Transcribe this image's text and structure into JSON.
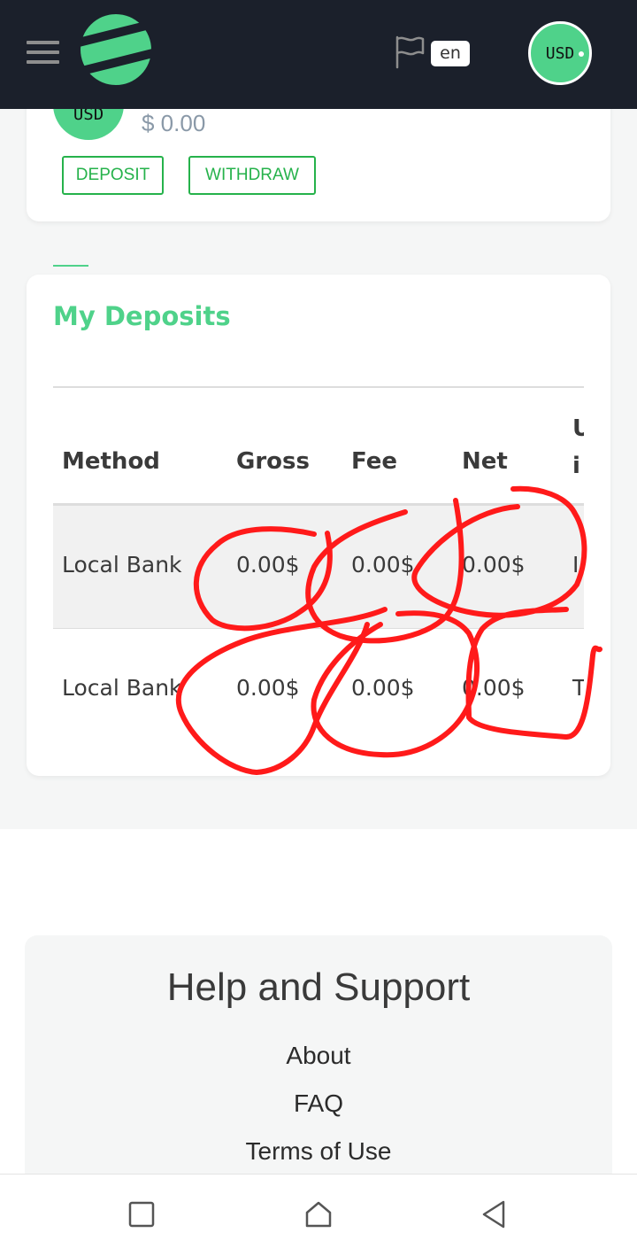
{
  "header": {
    "language": "en",
    "currency": "USD"
  },
  "balance": {
    "currency_badge": "USD",
    "amount": "$ 0.00",
    "deposit_label": "DEPOSIT",
    "withdraw_label": "WITHDRAW"
  },
  "deposits": {
    "title": "My Deposits",
    "columns": [
      "Method",
      "Gross",
      "Fee",
      "Net",
      "U\ni"
    ],
    "rows": [
      {
        "method": "Local Bank",
        "gross": "0.00$",
        "fee": "0.00$",
        "net": "0.00$",
        "extra": "I"
      },
      {
        "method": "Local Bank",
        "gross": "0.00$",
        "fee": "0.00$",
        "net": "0.00$",
        "extra": "T"
      }
    ]
  },
  "footer": {
    "title": "Help and Support",
    "links": [
      "About",
      "FAQ",
      "Terms of Use"
    ]
  },
  "colors": {
    "header_bg": "#1b202b",
    "brand_green": "#4fd28a",
    "button_green": "#26b24b",
    "annotation_red": "#ff1a1a"
  },
  "icons": {
    "menu": "hamburger-menu-icon",
    "logo": "brand-logo",
    "flag": "flag-icon",
    "nav_recent": "square-icon",
    "nav_home": "home-icon",
    "nav_back": "triangle-back-icon"
  }
}
